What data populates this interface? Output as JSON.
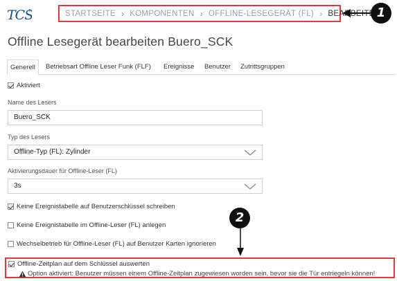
{
  "logo_text": "TCS",
  "breadcrumb": [
    "STARTSEITE",
    "KOMPONENTEN",
    "OFFLINE-LESEGERÄT (FL)",
    "BEARBEITEN"
  ],
  "breadcrumb_separator": "›",
  "page_title": "Offline Lesegerät bearbeiten Buero_SCK",
  "tabs": [
    "Generell",
    "Betriebsart Offline Leser Funk (FLF)",
    "Ereignisse",
    "Benutzer",
    "Zutrittsgruppen"
  ],
  "active_tab": "Generell",
  "form": {
    "aktiviert": {
      "label": "Aktiviert",
      "checked": true
    },
    "name_label": "Name des Lesers",
    "name_value": "Buero_SCK",
    "type_label": "Typ des Lesers",
    "type_value": "Offline-Typ (FL): Zylinder",
    "duration_label": "Aktivierungsdauer für Offline-Leser (FL)",
    "duration_value": "3s",
    "options": [
      {
        "label": "Keine Ereignistabelle auf Benutzerschlüssel schreiben",
        "checked": true
      },
      {
        "label": "Keine Ereignistabelle im Offline-Leser (FL) anlegen",
        "checked": false
      },
      {
        "label": "Wechselbetrieb für Offline-Leser (FL) auf Benutzer Karten ignorieren",
        "checked": false
      },
      {
        "label": "Offline-Zeitplan auf dem Schlüssel auswerten",
        "checked": true
      }
    ],
    "warning_text": "Option aktiviert: Benutzer müssen einem Offline-Zeitplan zugewiesen worden sein, bevor sie die Tür entriegeln können!"
  },
  "annotations": [
    "1",
    "2"
  ],
  "colors": {
    "highlight": "#e8353b",
    "badge": "#111111",
    "text": "#333333",
    "muted": "#9aa0a6",
    "warning": "#e2a400"
  },
  "icons": [
    "chevron-down-icon",
    "warning-icon",
    "checkbox-icon",
    "arrow-left-icon",
    "arrow-down-icon"
  ]
}
